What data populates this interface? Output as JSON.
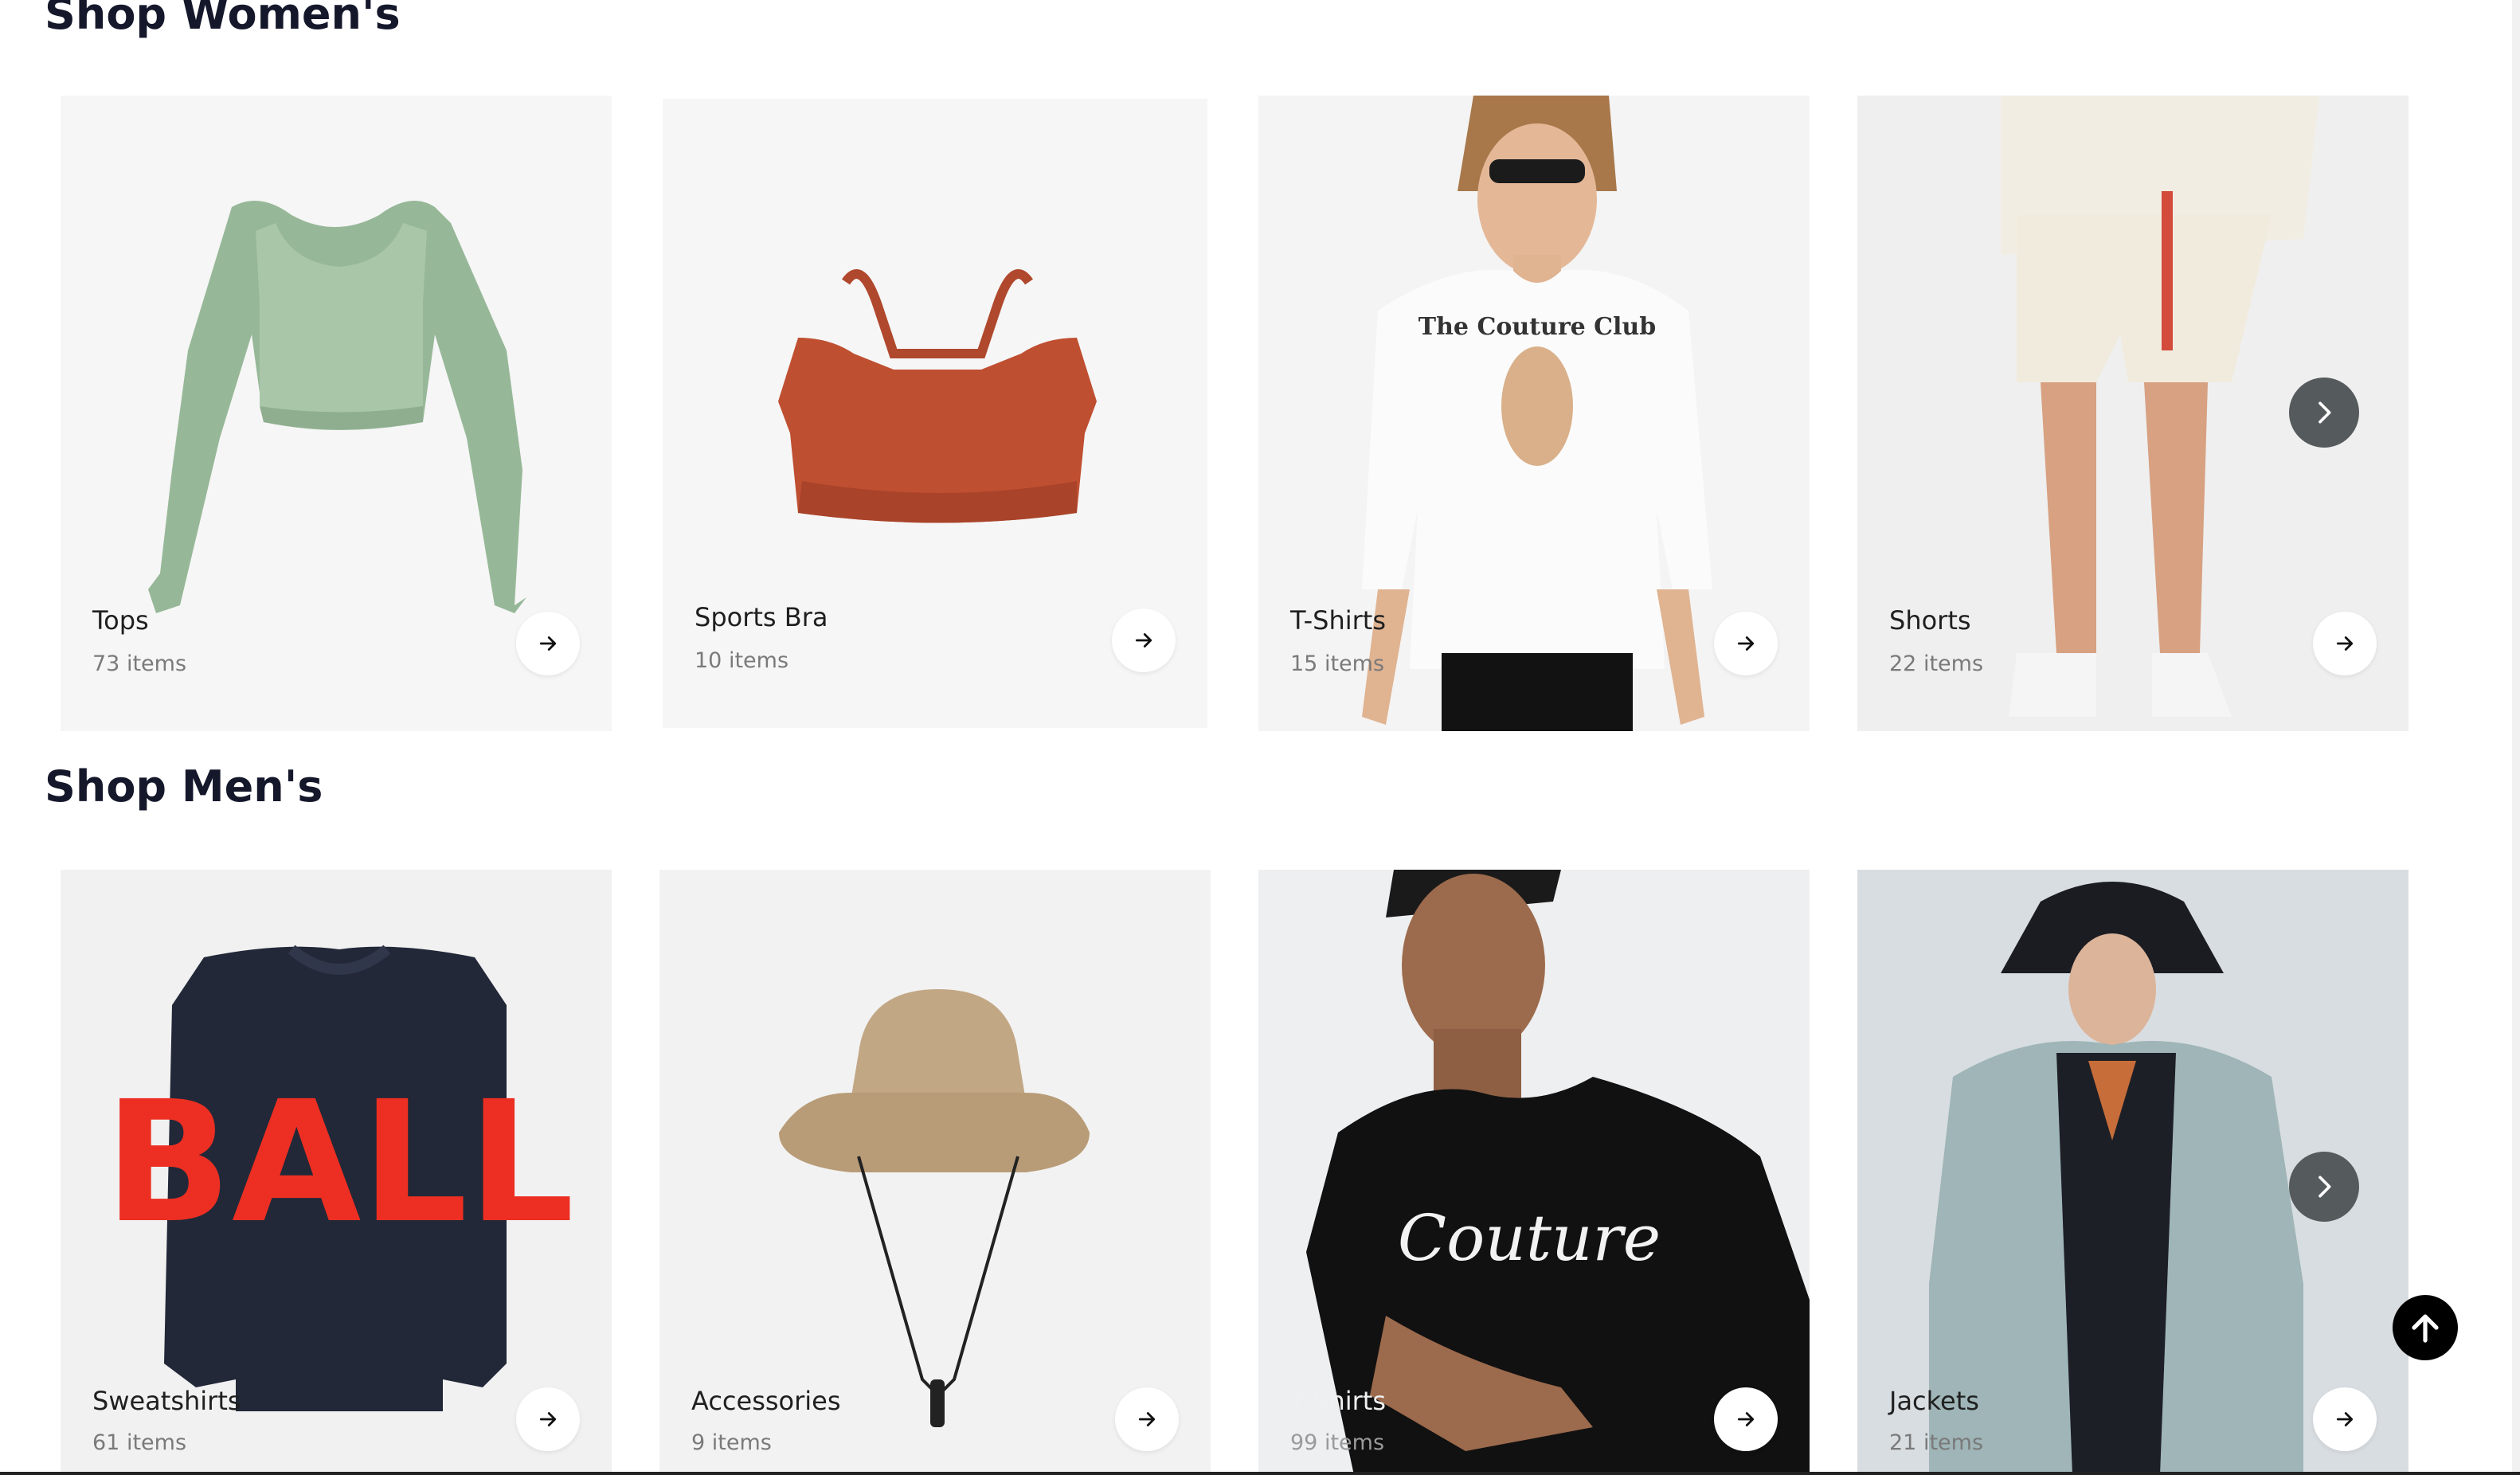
{
  "sections": {
    "women": {
      "title": "Shop Women's",
      "cards": [
        {
          "label": "Tops",
          "count": "73 items"
        },
        {
          "label": "Sports Bra",
          "count": "10 items"
        },
        {
          "label": "T-Shirts",
          "count": "15 items"
        },
        {
          "label": "Shorts",
          "count": "22 items"
        }
      ]
    },
    "men": {
      "title": "Shop Men's",
      "cards": [
        {
          "label": "Sweatshirts",
          "count": "61 items"
        },
        {
          "label": "Accessories",
          "count": "9 items"
        },
        {
          "label": "T-Shirts",
          "count": "99 items"
        },
        {
          "label": "Jackets",
          "count": "21 items"
        }
      ]
    }
  },
  "artwork": {
    "tshirt_print_text": "The Couture Club",
    "sweatshirt_print_text": "BALL",
    "men_tshirt_script_text": "Couture"
  },
  "icons": {
    "card_arrow": "arrow-right-icon",
    "carousel_next": "chevron-right-icon",
    "back_to_top": "arrow-up-icon"
  },
  "colors": {
    "heading": "#15182b",
    "card_bg": "#f6f6f6",
    "carousel_button": "#555a5d",
    "back_to_top_button": "#000000"
  }
}
